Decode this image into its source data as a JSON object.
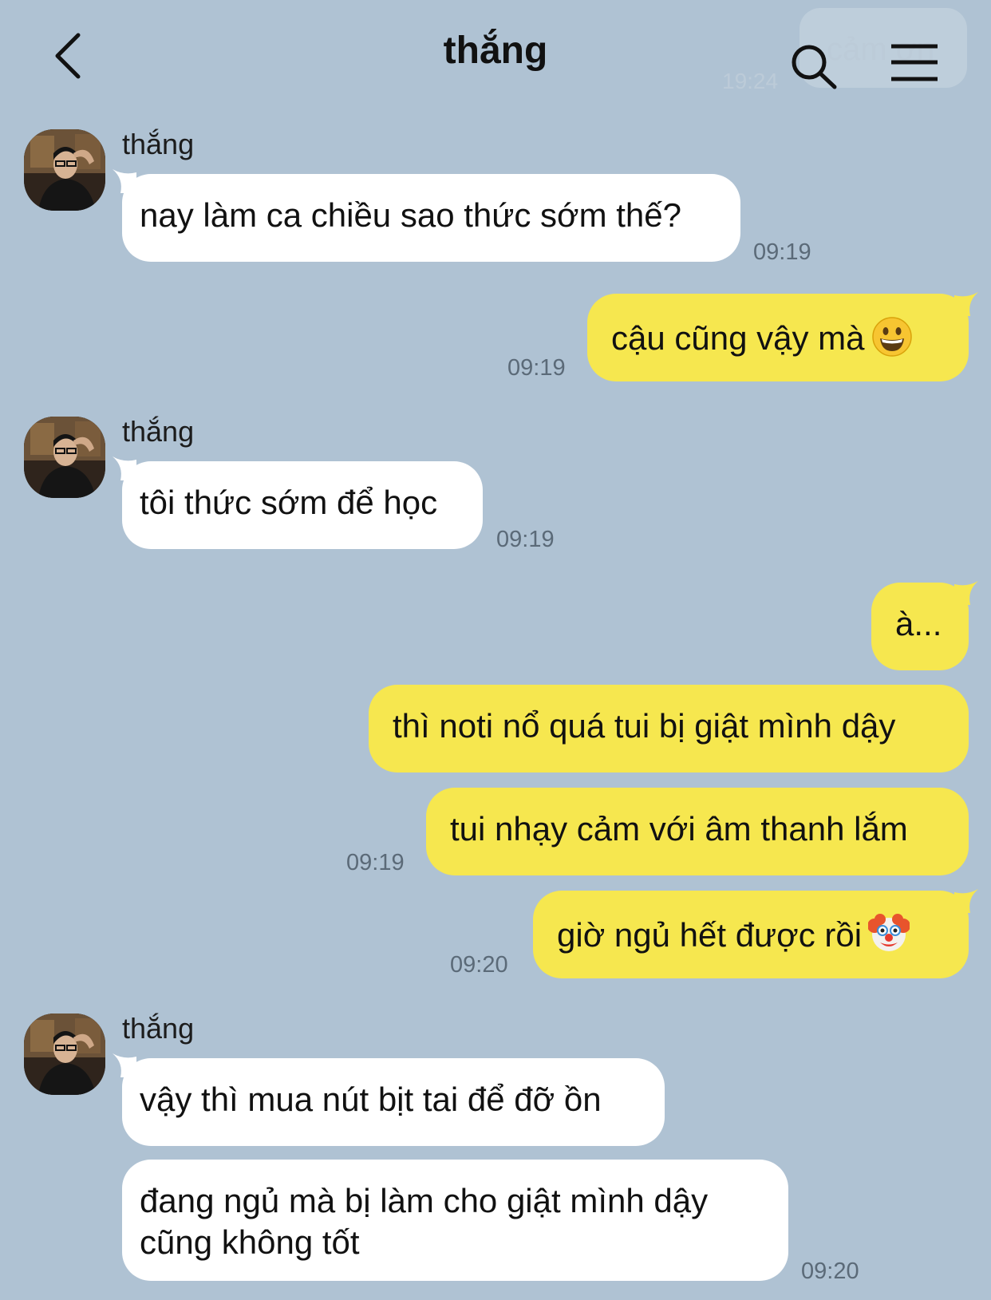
{
  "header": {
    "title": "thắng",
    "back_icon": "chevron-left-icon",
    "search_icon": "search-icon",
    "menu_icon": "menu-icon",
    "ghost_text": "cảm ơn",
    "ghost_time": "19:24"
  },
  "messages": [
    {
      "sender": "thắng",
      "direction": "incoming",
      "text": "nay làm ca chiều sao thức sớm thế?",
      "time": "09:19"
    },
    {
      "direction": "outgoing",
      "text": "cậu cũng vậy mà",
      "emoji": "grinning-face-emoji",
      "time": "09:19"
    },
    {
      "sender": "thắng",
      "direction": "incoming",
      "text": "tôi thức sớm để học",
      "time": "09:19"
    },
    {
      "direction": "outgoing",
      "text": "à..."
    },
    {
      "direction": "outgoing",
      "text": "thì noti nổ quá tui bị giật mình dậy"
    },
    {
      "direction": "outgoing",
      "text": "tui nhạy cảm với âm thanh lắm",
      "time": "09:19"
    },
    {
      "direction": "outgoing",
      "text": "giờ ngủ hết được rồi",
      "emoji": "clown-face-emoji",
      "time": "09:20"
    },
    {
      "sender": "thắng",
      "direction": "incoming",
      "text": "vậy thì mua nút bịt tai để đỡ ồn"
    },
    {
      "direction": "incoming",
      "text": "đang ngủ mà bị làm cho giật mình dậy cũng không tốt",
      "time": "09:20"
    }
  ],
  "colors": {
    "background": "#afc2d3",
    "incoming_bubble": "#ffffff",
    "outgoing_bubble": "#f6e74f",
    "timestamp": "#5b6a78"
  }
}
